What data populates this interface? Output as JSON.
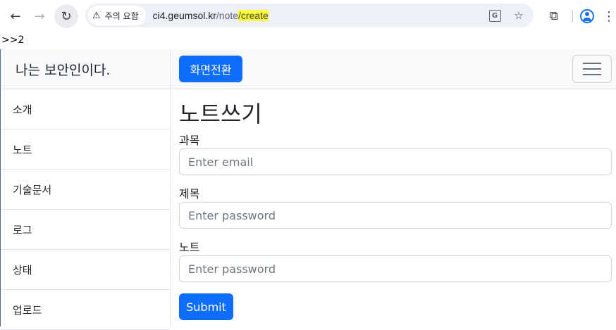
{
  "browser": {
    "security_label": "주의 요함",
    "url_host": "ci4.geumsol.kr",
    "url_path": "/note",
    "url_highlight": "/create"
  },
  "debug_text": ">>2",
  "sidebar": {
    "heading": "나는 보안인이다.",
    "items": [
      {
        "label": "소개"
      },
      {
        "label": "노트"
      },
      {
        "label": "기술문서"
      },
      {
        "label": "로그"
      },
      {
        "label": "상태"
      },
      {
        "label": "업로드"
      }
    ]
  },
  "topnav": {
    "toggle_label": "화면전환"
  },
  "form": {
    "title": "노트쓰기",
    "fields": [
      {
        "label": "과목",
        "placeholder": "Enter email"
      },
      {
        "label": "제목",
        "placeholder": "Enter password"
      },
      {
        "label": "노트",
        "placeholder": "Enter password"
      }
    ],
    "submit_label": "Submit"
  },
  "colors": {
    "primary": "#0d6efd",
    "url_highlight": "#ffff3b"
  }
}
